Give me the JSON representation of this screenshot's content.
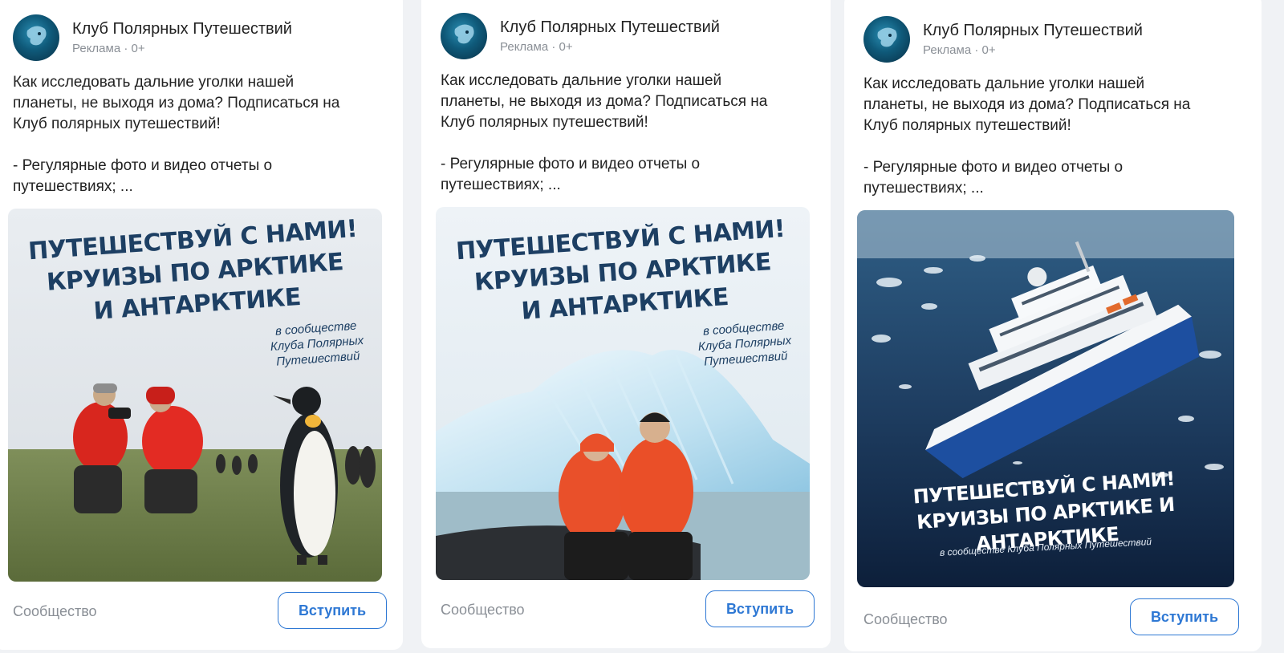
{
  "cards": [
    {
      "group_name": "Клуб Полярных Путешествий",
      "ad_label": "Реклама · 0+",
      "text": "Как исследовать дальние уголки нашей\nпланеты, не выходя из дома? Подписаться на\nКлуб полярных путешествий!\n\n- Регулярные фото и видео отчеты о\nпутешествиях; ...",
      "banner_title": "ПУТЕШЕСТВУЙ С НАМИ!\nКРУИЗЫ ПО АРКТИКЕ\nИ АНТАРКТИКЕ",
      "banner_sub": "в сообществе\nКлуба Полярных\nПутешествий",
      "footer_label": "Сообщество",
      "button_label": "Вступить"
    },
    {
      "group_name": "Клуб Полярных Путешествий",
      "ad_label": "Реклама · 0+",
      "text": "Как исследовать дальние уголки нашей\nпланеты, не выходя из дома? Подписаться на\nКлуб полярных путешествий!\n\n- Регулярные фото и видео отчеты о\nпутешествиях; ...",
      "banner_title": "ПУТЕШЕСТВУЙ С НАМИ!\nКРУИЗЫ ПО АРКТИКЕ\nИ АНТАРКТИКЕ",
      "banner_sub": "в сообществе\nКлуба Полярных\nПутешествий",
      "footer_label": "Сообщество",
      "button_label": "Вступить"
    },
    {
      "group_name": "Клуб Полярных Путешествий",
      "ad_label": "Реклама · 0+",
      "text": "Как исследовать дальние уголки нашей\nпланеты, не выходя из дома? Подписаться на\nКлуб полярных путешествий!\n\n- Регулярные фото и видео отчеты о\nпутешествиях; ...",
      "banner_title": "ПУТЕШЕСТВУЙ С НАМИ!\nКРУИЗЫ ПО АРКТИКЕ И АНТАРКТИКЕ",
      "banner_sub": "в сообществе Клуба Полярных Путешествий",
      "footer_label": "Сообщество",
      "button_label": "Вступить"
    }
  ],
  "colors": {
    "accent": "#2e78d4",
    "banner_title_dark": "#1d3f63",
    "banner_title_light": "#ffffff",
    "muted_text": "#8a8f96"
  },
  "icons": {
    "avatar": "polar-club-logo-icon"
  }
}
